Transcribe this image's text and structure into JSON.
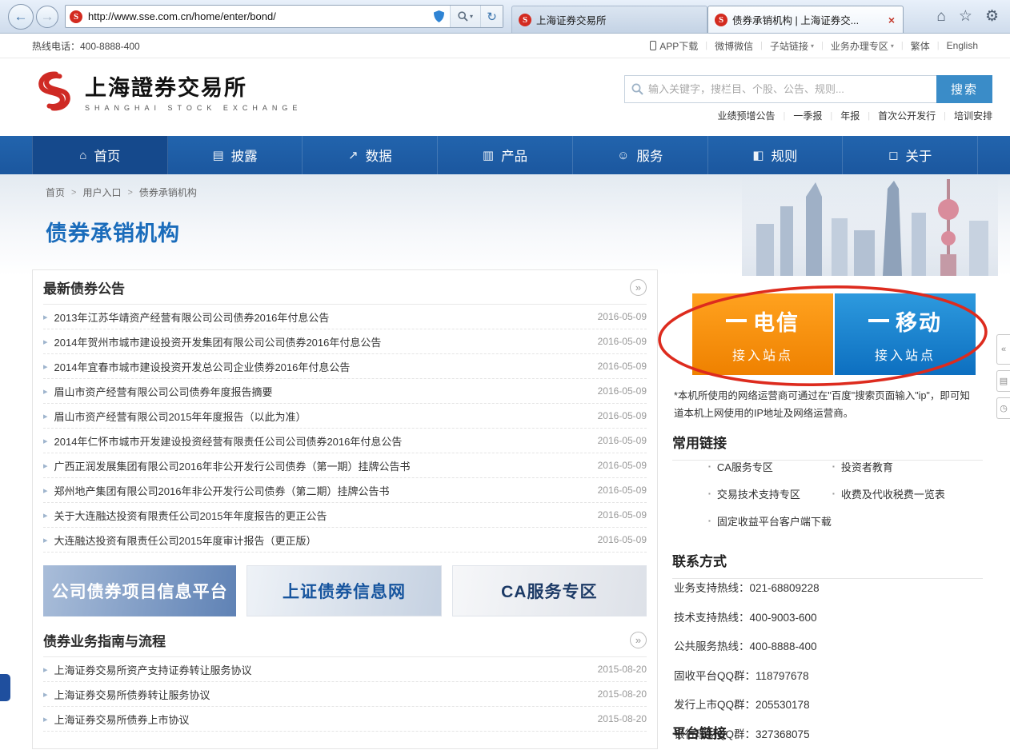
{
  "browser": {
    "url": "http://www.sse.com.cn/home/enter/bond/",
    "tabs": [
      {
        "title": "上海证券交易所"
      },
      {
        "title": "债券承销机构 | 上海证券交..."
      }
    ],
    "close_glyph": "×"
  },
  "icons": {
    "back": "←",
    "forward": "→",
    "refresh": "↻",
    "caret": "▾",
    "home": "⌂",
    "star": "☆",
    "gear": "⚙",
    "bullet": "▸",
    "chevron": "»",
    "square": "▪",
    "collapse": "«",
    "doc": "▤",
    "clock": "◷",
    "pipe": "|",
    "crumb_sep": ">"
  },
  "topbar": {
    "hotline": "热线电话：400-8888-400",
    "links": [
      "APP下载",
      "微博微信",
      "子站链接",
      "业务办理专区",
      "繁体",
      "English"
    ]
  },
  "header": {
    "logo_cn": "上海證券交易所",
    "logo_en": "SHANGHAI STOCK EXCHANGE",
    "search_placeholder": "输入关键字，搜栏目、个股、公告、规则...",
    "search_button": "搜索",
    "quick_links": [
      "业绩预增公告",
      "一季报",
      "年报",
      "首次公开发行",
      "培训安排"
    ]
  },
  "nav": {
    "items": [
      {
        "label": "首页",
        "icon": "⌂"
      },
      {
        "label": "披露",
        "icon": "▤"
      },
      {
        "label": "数据",
        "icon": "↗"
      },
      {
        "label": "产品",
        "icon": "▥"
      },
      {
        "label": "服务",
        "icon": "☺"
      },
      {
        "label": "规则",
        "icon": "◧"
      },
      {
        "label": "关于",
        "icon": "◻"
      }
    ]
  },
  "breadcrumb": {
    "items": [
      "首页",
      "用户入口",
      "债券承销机构"
    ],
    "separator": ">"
  },
  "page": {
    "title": "债券承销机构"
  },
  "announcements": {
    "title": "最新债券公告",
    "items": [
      {
        "text": "2013年江苏华靖资产经营有限公司公司债券2016年付息公告",
        "date": "2016-05-09"
      },
      {
        "text": "2014年贺州市城市建设投资开发集团有限公司公司债券2016年付息公告",
        "date": "2016-05-09"
      },
      {
        "text": "2014年宜春市城市建设投资开发总公司企业债券2016年付息公告",
        "date": "2016-05-09"
      },
      {
        "text": "眉山市资产经营有限公司公司债券年度报告摘要",
        "date": "2016-05-09"
      },
      {
        "text": "眉山市资产经营有限公司2015年年度报告（以此为准）",
        "date": "2016-05-09"
      },
      {
        "text": "2014年仁怀市城市开发建设投资经营有限责任公司公司债券2016年付息公告",
        "date": "2016-05-09"
      },
      {
        "text": "广西正润发展集团有限公司2016年非公开发行公司债券（第一期）挂牌公告书",
        "date": "2016-05-09"
      },
      {
        "text": "郑州地产集团有限公司2016年非公开发行公司债券（第二期）挂牌公告书",
        "date": "2016-05-09"
      },
      {
        "text": "关于大连融达投资有限责任公司2015年年度报告的更正公告",
        "date": "2016-05-09"
      },
      {
        "text": "大连融达投资有限责任公司2015年度审计报告（更正版）",
        "date": "2016-05-09"
      }
    ]
  },
  "banners": [
    "公司债券项目信息平台",
    "上证债券信息网",
    "CA服务专区"
  ],
  "guides": {
    "title": "债券业务指南与流程",
    "items": [
      {
        "text": "上海证券交易所资产支持证券转让服务协议",
        "date": "2015-08-20"
      },
      {
        "text": "上海证券交易所债券转让服务协议",
        "date": "2015-08-20"
      },
      {
        "text": "上海证券交易所债券上市协议",
        "date": "2015-08-20"
      }
    ]
  },
  "access": {
    "telecom_main": "电信",
    "telecom_sub": "接入站点",
    "mobile_main": "移动",
    "mobile_sub": "接入站点",
    "note": "*本机所使用的网络运营商可通过在\"百度\"搜索页面输入\"ip\"，即可知道本机上网使用的IP地址及网络运营商。"
  },
  "links": {
    "title": "常用链接",
    "left": [
      "CA服务专区",
      "交易技术支持专区",
      "固定收益平台客户端下载"
    ],
    "right": [
      "投资者教育",
      "收费及代收税费一览表"
    ]
  },
  "contact": {
    "title": "联系方式",
    "lines": [
      "业务支持热线：021-68809228",
      "技术支持热线：400-9003-600",
      "公共服务热线：400-8888-400",
      "固收平台QQ群：118797678",
      "发行上市QQ群：205530178",
      "银行理财QQ群：327368075"
    ]
  },
  "extra": {
    "partial_heading": "平台链接"
  }
}
